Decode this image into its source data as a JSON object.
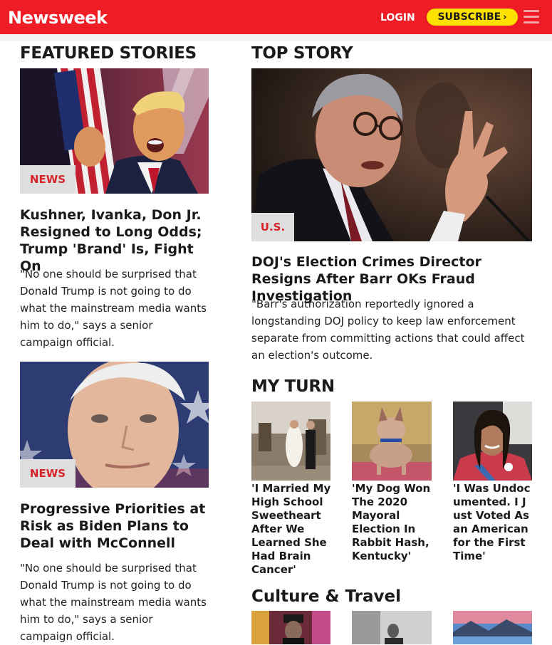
{
  "header": {
    "logo": "Newsweek",
    "login": "LOGIN",
    "subscribe": "SUBSCRIBE",
    "menu_icon": "hamburger-menu-icon"
  },
  "featured": {
    "title": "FEATURED STORIES",
    "stories": [
      {
        "tag": "NEWS",
        "headline": "Kushner, Ivanka, Don Jr. Resigned to Long Odds; Trump 'Brand' Is, Fight On",
        "dek": "\"No one should be surprised that Donald Trump is not going to do what the mainstream media wants him to do,\" says a senior campaign official."
      },
      {
        "tag": "NEWS",
        "headline": "Progressive Priorities at Risk as Biden Plans to Deal with McConnell",
        "dek": "\"No one should be surprised that Donald Trump is not going to do what the mainstream media wants him to do,\" says a senior campaign official."
      }
    ]
  },
  "top_story": {
    "title": "TOP STORY",
    "tag": "U.S.",
    "headline": "DOJ's Election Crimes Director Resigns After Barr OKs Fraud Investigation",
    "dek": "\"Barr's authorization reportedly ignored a longstanding DOJ policy to keep law enforcement separate from committing actions that could affect an election's outcome."
  },
  "my_turn": {
    "title": "MY TURN",
    "items": [
      {
        "headline": "'I Married My High School Sweetheart After We Learned She Had Brain Cancer'"
      },
      {
        "headline": "'My Dog Won The 2020 Mayoral Election In Rabbit Hash, Kentucky'"
      },
      {
        "headline": "'I Was Undocumented. I Just Voted As an American for the First Time'"
      }
    ]
  },
  "culture_travel": {
    "title": "Culture & Travel"
  },
  "colors": {
    "brand_red": "#ee1c25",
    "subscribe_yellow": "#ffe100",
    "tag_bg": "#dedede",
    "tag_text": "#d8232a"
  }
}
